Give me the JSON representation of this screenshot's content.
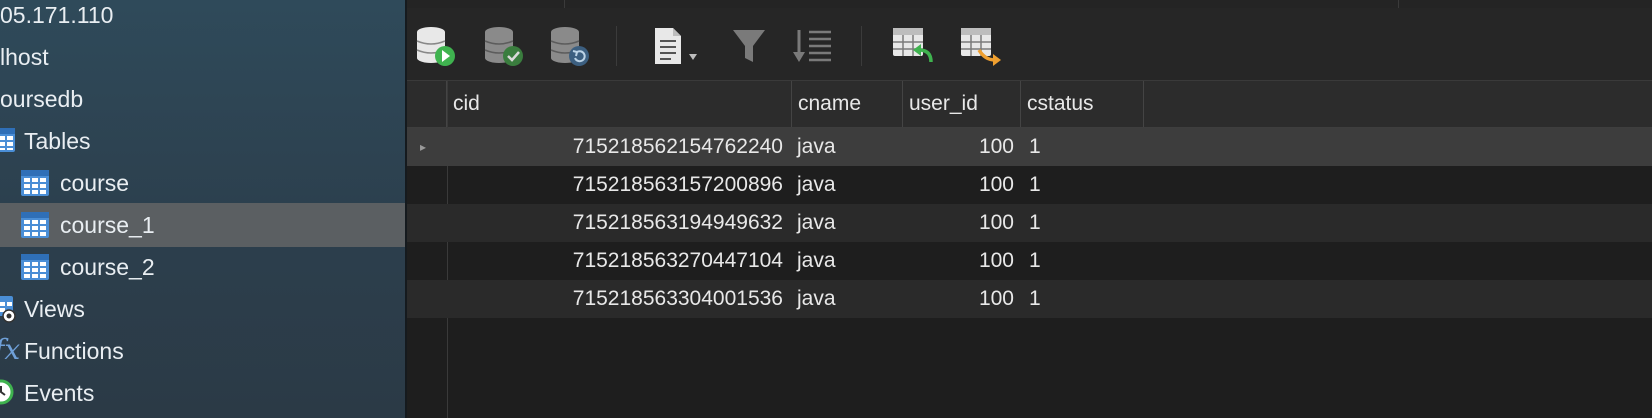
{
  "sidebar": {
    "items": [
      {
        "label": "05.171.110"
      },
      {
        "label": "lhost"
      },
      {
        "label": "oursedb"
      },
      {
        "label": "Tables"
      },
      {
        "label": "course"
      },
      {
        "label": "course_1"
      },
      {
        "label": "course_2"
      },
      {
        "label": "Views"
      },
      {
        "label": "Functions"
      },
      {
        "label": "Events"
      }
    ],
    "selected": "course_1"
  },
  "toolbar": {
    "buttons": [
      {
        "icon": "database-run-icon"
      },
      {
        "icon": "database-commit-icon"
      },
      {
        "icon": "database-rollback-icon"
      },
      {
        "icon": "document-dropdown-icon"
      },
      {
        "icon": "filter-icon"
      },
      {
        "icon": "sort-icon"
      },
      {
        "icon": "import-table-icon"
      },
      {
        "icon": "export-table-icon"
      }
    ]
  },
  "table": {
    "columns": [
      "cid",
      "cname",
      "user_id",
      "cstatus"
    ],
    "rows": [
      [
        "715218562154762240",
        "java",
        "100",
        "1"
      ],
      [
        "715218563157200896",
        "java",
        "100",
        "1"
      ],
      [
        "715218563194949632",
        "java",
        "100",
        "1"
      ],
      [
        "715218563270447104",
        "java",
        "100",
        "1"
      ],
      [
        "715218563304001536",
        "java",
        "100",
        "1"
      ]
    ],
    "current_row_marker": "▸"
  },
  "colors": {
    "sidebar_top": "#2f4a5a",
    "sidebar_selected": "#5b5f62",
    "grid_background": "#1e1e1e",
    "accent_green": "#3fb34f",
    "accent_orange": "#f0a030",
    "table_icon_blue": "#4a8ed6"
  }
}
